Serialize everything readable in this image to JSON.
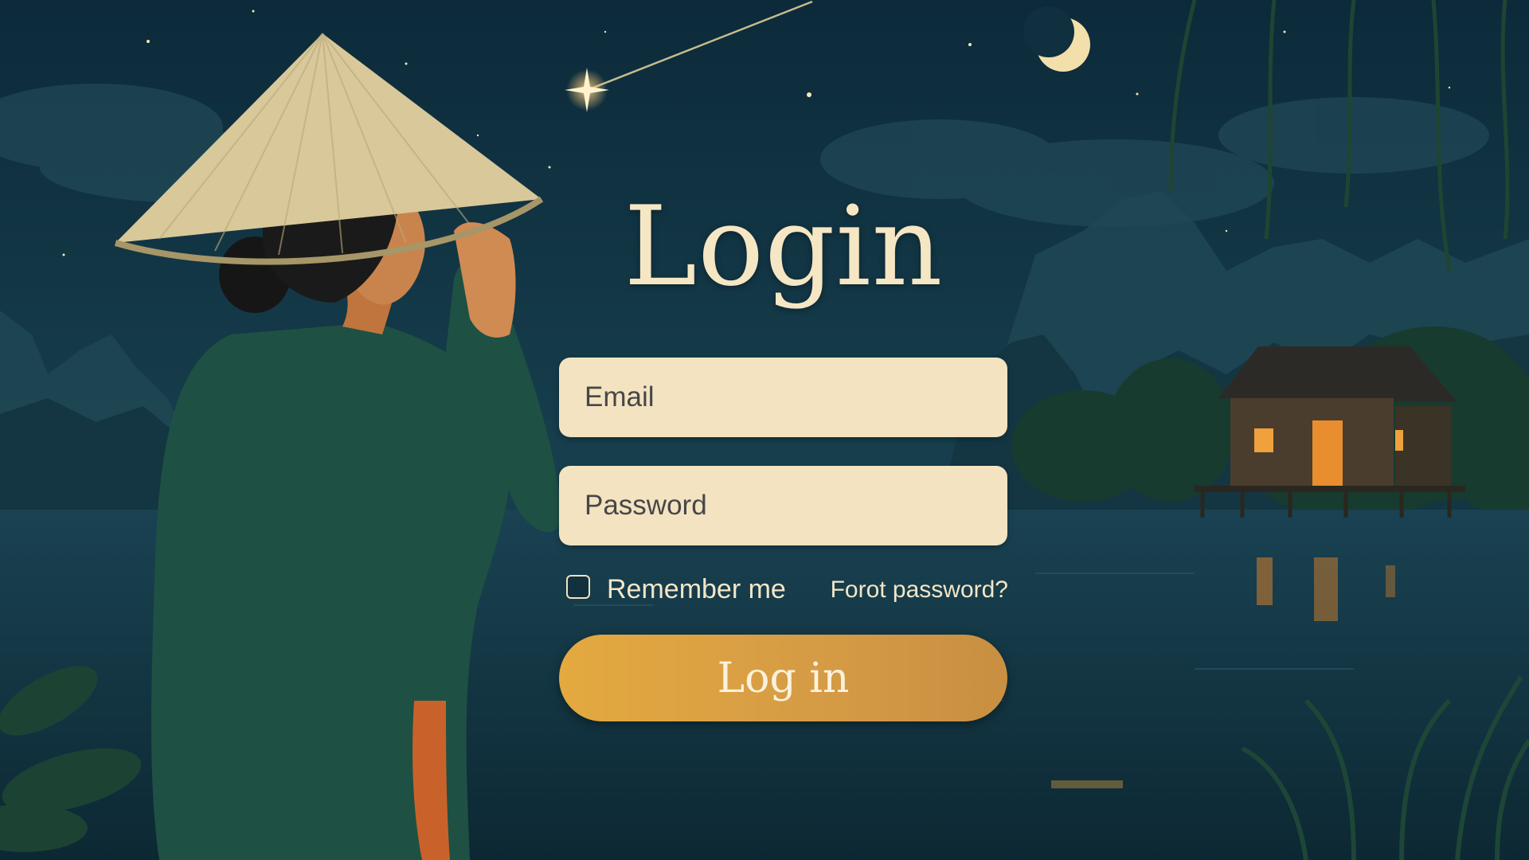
{
  "login": {
    "title": "Login",
    "email_placeholder": "Email",
    "password_placeholder": "Password",
    "remember_label": "Remember me",
    "remember_checked": false,
    "forgot_label": "Forot password?",
    "submit_label": "Log in"
  },
  "colors": {
    "sky": "#0f2f3e",
    "field_bg": "#f3e3c1",
    "title": "#f5e6c4",
    "button": "#e4a93f"
  }
}
